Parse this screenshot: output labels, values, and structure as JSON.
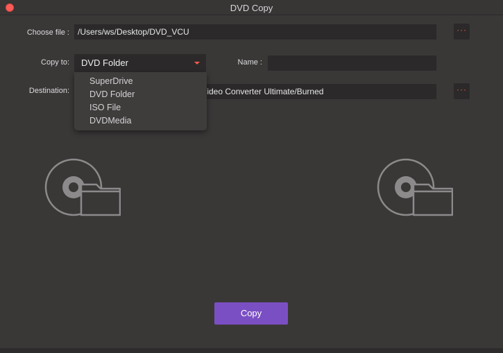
{
  "window": {
    "title": "DVD Copy"
  },
  "form": {
    "choose_file_label": "Choose file :",
    "choose_file_value": "/Users/ws/Desktop/DVD_VCU",
    "copy_to_label": "Copy to:",
    "copy_to_selected": "DVD Folder",
    "name_label": "Name :",
    "name_value": "",
    "destination_label": "Destination:",
    "destination_value": "/ideo Converter Ultimate/Burned",
    "browse_label": "···"
  },
  "dropdown": {
    "options": [
      "SuperDrive",
      "DVD Folder",
      "ISO File",
      "DVDMedia"
    ]
  },
  "actions": {
    "copy_label": "Copy"
  },
  "colors": {
    "accent": "#7b4fc4",
    "dots": "#ff5a4e",
    "background": "#3a3737",
    "field": "#2b2929"
  },
  "icons": [
    "close-icon",
    "disc-folder-icon",
    "chevron-down-icon"
  ]
}
